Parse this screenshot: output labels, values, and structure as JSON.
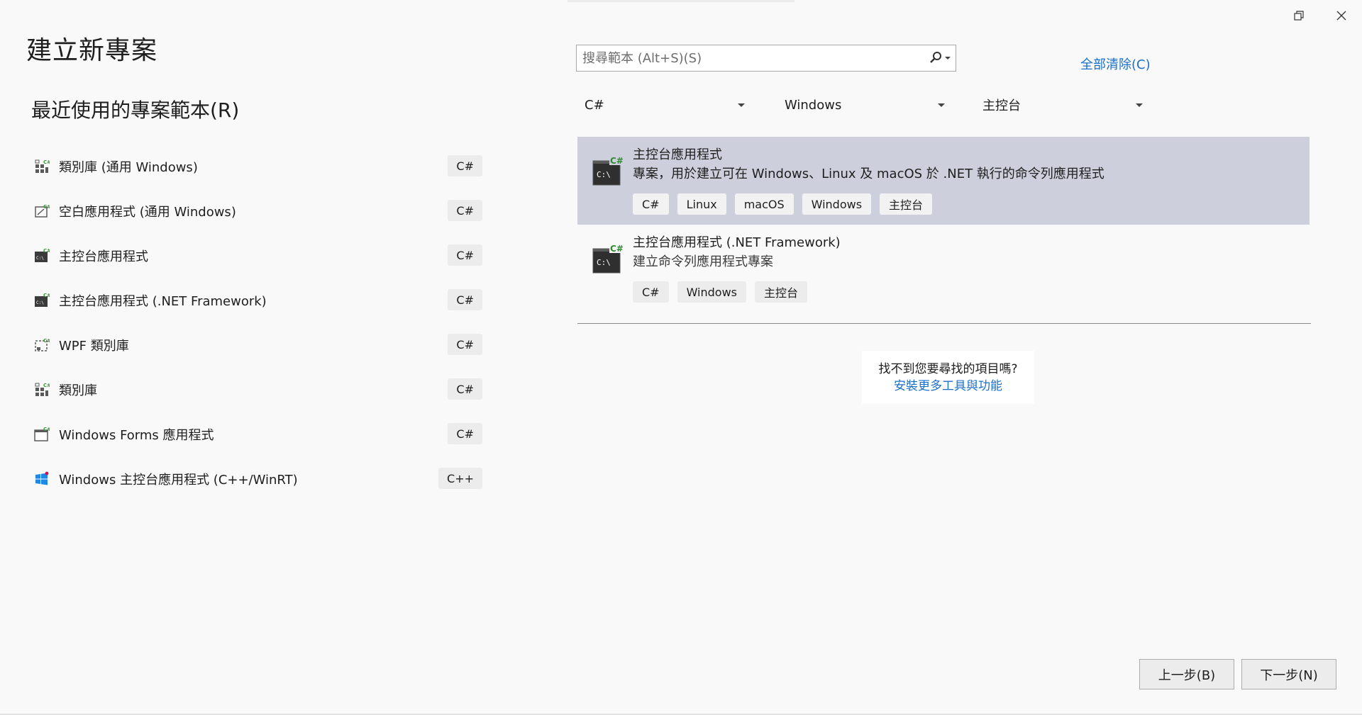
{
  "window": {
    "restore_icon": "restore-icon",
    "close_icon": "close-icon"
  },
  "page_title": "建立新專案",
  "recent": {
    "title": "最近使用的專案範本(R)",
    "items": [
      {
        "label": "類別庫 (通用 Windows)",
        "lang": "C#",
        "icon": "class-library-icon"
      },
      {
        "label": "空白應用程式 (通用 Windows)",
        "lang": "C#",
        "icon": "blank-app-icon"
      },
      {
        "label": "主控台應用程式",
        "lang": "C#",
        "icon": "console-app-icon"
      },
      {
        "label": "主控台應用程式 (.NET Framework)",
        "lang": "C#",
        "icon": "console-app-icon"
      },
      {
        "label": "WPF 類別庫",
        "lang": "C#",
        "icon": "wpf-library-icon"
      },
      {
        "label": "類別庫",
        "lang": "C#",
        "icon": "class-library-icon"
      },
      {
        "label": "Windows Forms 應用程式",
        "lang": "C#",
        "icon": "windows-forms-icon"
      },
      {
        "label": "Windows 主控台應用程式 (C++/WinRT)",
        "lang": "C++",
        "icon": "windows-logo-icon"
      }
    ]
  },
  "search": {
    "placeholder": "搜尋範本 (Alt+S)(S)",
    "value": ""
  },
  "clear_all": "全部清除(C)",
  "filters": {
    "language": "C#",
    "platform": "Windows",
    "project_type": "主控台"
  },
  "results": [
    {
      "title": "主控台應用程式",
      "description": "專案，用於建立可在 Windows、Linux 及 macOS 於 .NET 執行的命令列應用程式",
      "tags": [
        "C#",
        "Linux",
        "macOS",
        "Windows",
        "主控台"
      ],
      "selected": true
    },
    {
      "title": "主控台應用程式 (.NET Framework)",
      "description": "建立命令列應用程式專案",
      "tags": [
        "C#",
        "Windows",
        "主控台"
      ],
      "selected": false
    }
  ],
  "not_found": {
    "question": "找不到您要尋找的項目嗎?",
    "link": "安裝更多工具與功能"
  },
  "buttons": {
    "back": "上一步(B)",
    "next": "下一步(N)"
  },
  "colors": {
    "background": "#f9f9f9",
    "selected_row": "#cdd0dc",
    "link": "#1a6fc9",
    "csharp_badge": "#3a9a3a"
  }
}
